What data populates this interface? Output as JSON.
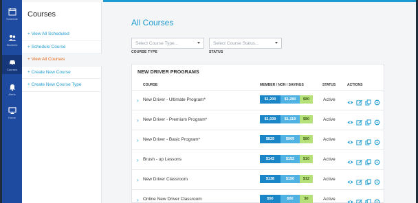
{
  "rail": {
    "items": [
      {
        "label": "Schedule",
        "icon": "calendar-icon"
      },
      {
        "label": "Students",
        "icon": "users-icon"
      },
      {
        "label": "Courses",
        "icon": "car-icon"
      },
      {
        "label": "Alerts",
        "icon": "bell-icon"
      },
      {
        "label": "Home",
        "icon": "monitor-icon"
      }
    ]
  },
  "sidebar": {
    "title": "Courses",
    "items": [
      {
        "label": "+ View All Scheduled"
      },
      {
        "label": "+ Schedule Course"
      },
      {
        "label": "+ View All Courses"
      },
      {
        "label": "+ Create New Course"
      },
      {
        "label": "+ Create New Course Type"
      }
    ]
  },
  "main": {
    "title": "All Courses",
    "filters": {
      "course_type": {
        "placeholder": "Select Course Type...",
        "label": "COURSE TYPE"
      },
      "status": {
        "placeholder": "Select Course Status...",
        "label": "STATUS"
      }
    },
    "panel": {
      "title": "NEW DRIVER PROGRAMS",
      "columns": {
        "course": "COURSE",
        "pricing": "MEMBER / NON / SAVINGS",
        "status": "STATUS",
        "actions": "ACTIONS"
      },
      "rows": [
        {
          "name": "New Driver - Ultimate Program*",
          "member": "$1,200",
          "non": "$1,280",
          "savings": "$80",
          "status": "Active"
        },
        {
          "name": "New Driver - Premium Program*",
          "member": "$1,039",
          "non": "$1,119",
          "savings": "$80",
          "status": "Active"
        },
        {
          "name": "New Driver - Basic Program*",
          "member": "$829",
          "non": "$909",
          "savings": "$80",
          "status": "Active"
        },
        {
          "name": "Brush - up Lessons",
          "member": "$142",
          "non": "$152",
          "savings": "$10",
          "status": "Active"
        },
        {
          "name": "New Driver Classroom",
          "member": "$138",
          "non": "$150",
          "savings": "$12",
          "status": "Active"
        },
        {
          "name": "Online New Driver Classroom",
          "member": "$50",
          "non": "$50",
          "savings": "$0",
          "status": "Active"
        }
      ]
    }
  },
  "colors": {
    "accent": "#1d9bd1",
    "rail": "#1e4aa0",
    "active_link": "#e0691b",
    "member": "#1a86c8",
    "non": "#4fb2e3",
    "savings": "#b6e07a"
  }
}
